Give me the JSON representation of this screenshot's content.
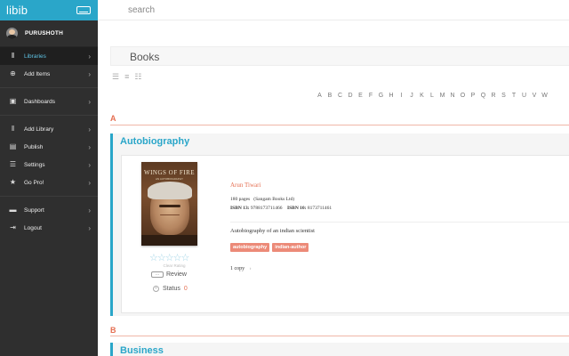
{
  "app": {
    "name": "libib"
  },
  "user": {
    "name": "PURUSHOTH"
  },
  "nav": [
    {
      "label": "Libraries",
      "icon": "libraries-icon",
      "active": true
    },
    {
      "label": "Add Items",
      "icon": "add-icon"
    },
    {
      "label": "Dashboards",
      "icon": "dashboard-icon"
    },
    {
      "label": "Add Library",
      "icon": "add-library-icon"
    },
    {
      "label": "Publish",
      "icon": "publish-icon"
    },
    {
      "label": "Settings",
      "icon": "settings-icon"
    },
    {
      "label": "Go Pro!",
      "icon": "trophy-icon"
    },
    {
      "label": "Support",
      "icon": "support-icon"
    },
    {
      "label": "Logout",
      "icon": "logout-icon"
    }
  ],
  "search": {
    "placeholder": "search"
  },
  "page": {
    "title": "Books"
  },
  "alphabet": [
    "A",
    "B",
    "C",
    "D",
    "E",
    "F",
    "G",
    "H",
    "I",
    "J",
    "K",
    "L",
    "M",
    "N",
    "O",
    "P",
    "Q",
    "R",
    "S",
    "T",
    "U",
    "V",
    "W"
  ],
  "sections": [
    {
      "letter": "A",
      "genre": "Autobiography"
    },
    {
      "letter": "B",
      "genre": "Business"
    }
  ],
  "book": {
    "cover_title": "WINGS OF FIRE",
    "cover_subtitle": "AN AUTOBIOGRAPHY",
    "author": "Arun Tiwari",
    "pages": "180 pages",
    "publisher": "(Sangam Books Ltd)",
    "isbn13_label": "ISBN 13:",
    "isbn13": "9788173711466",
    "isbn10_label": "ISBN 10:",
    "isbn10": "8173711461",
    "description": "Autobiography of an indian scientist",
    "tags": [
      "autobiography",
      "indian-author"
    ],
    "copies": "1 copy",
    "rating_stars": "☆☆☆☆☆",
    "clear_rating": "Clear Rating",
    "review_label": "Review",
    "status_label": "Status",
    "status_value": "0"
  },
  "colors": {
    "accent": "#2aa6c9",
    "tag": "#ec8a78",
    "letter": "#e56f52",
    "sidebar": "#2f2f2f"
  }
}
